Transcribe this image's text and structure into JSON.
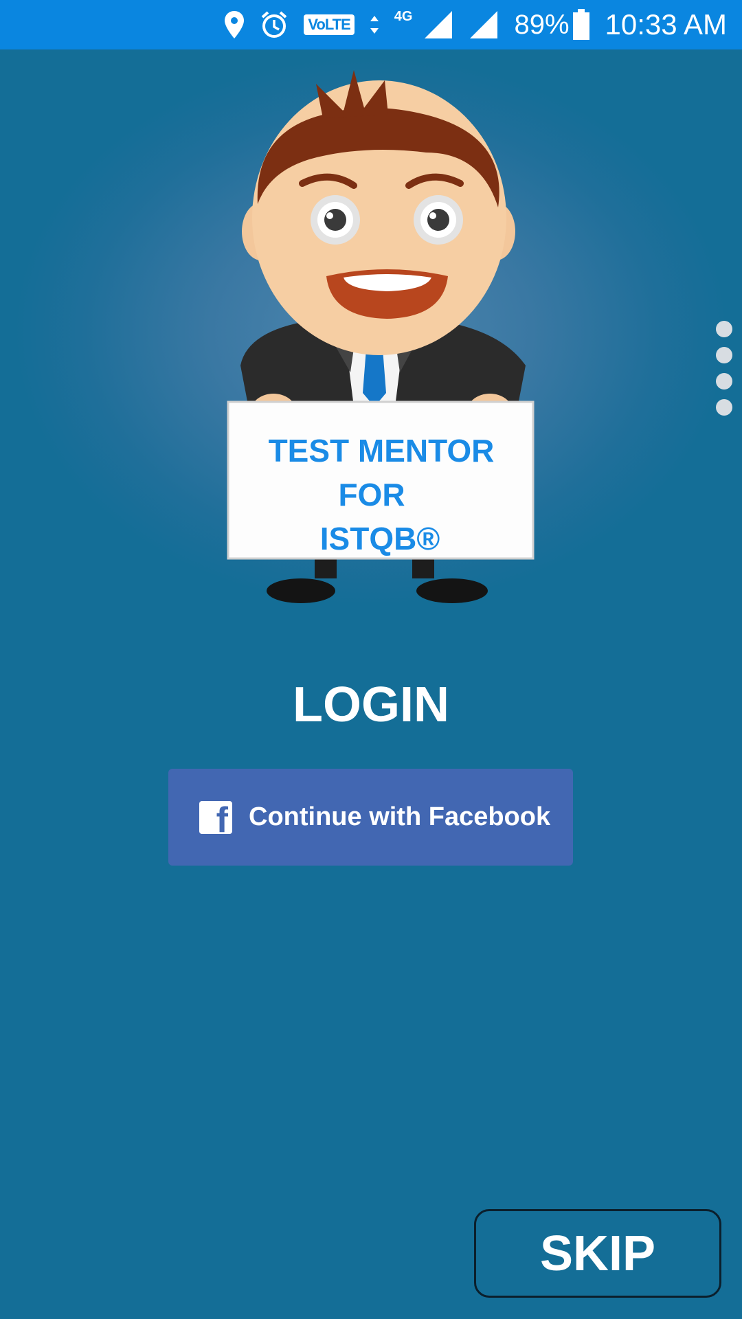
{
  "status_bar": {
    "volte": "VoLTE",
    "network": "4G",
    "battery": "89%",
    "time": "10:33 AM"
  },
  "hero": {
    "sign_lines": [
      "TEST MENTOR",
      "FOR",
      "ISTQB®"
    ],
    "pager_dots": 4
  },
  "login": {
    "title": "LOGIN",
    "facebook_button": "Continue with Facebook"
  },
  "skip": "SKIP",
  "colors": {
    "status_bar": "#0a86e0",
    "background": "#146e97",
    "facebook": "#4267b2",
    "sign_text": "#1a8be6"
  }
}
